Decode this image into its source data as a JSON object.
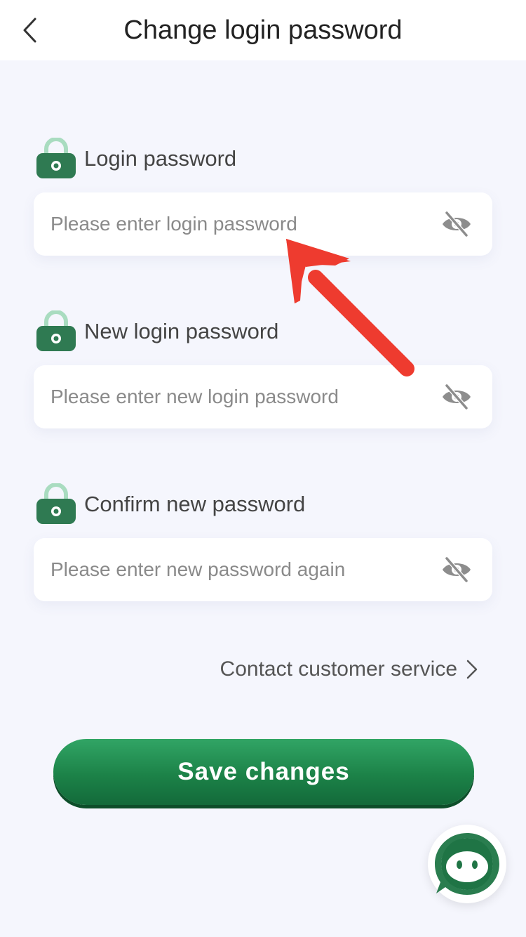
{
  "header": {
    "title": "Change login password",
    "back_icon": "chevron-left-icon"
  },
  "fields": [
    {
      "label": "Login password",
      "placeholder": "Please enter login password",
      "value": "",
      "icon": "lock-icon",
      "toggle_icon": "eye-off-icon"
    },
    {
      "label": "New login password",
      "placeholder": "Please enter new login password",
      "value": "",
      "icon": "lock-icon",
      "toggle_icon": "eye-off-icon"
    },
    {
      "label": "Confirm new password",
      "placeholder": "Please enter new password again",
      "value": "",
      "icon": "lock-icon",
      "toggle_icon": "eye-off-icon"
    }
  ],
  "contact": {
    "label": "Contact customer service",
    "icon": "chevron-right-icon"
  },
  "save_button": {
    "label": "Save changes"
  },
  "chat_widget": {
    "icon": "chat-bubble-icon"
  },
  "annotation": {
    "icon": "red-arrow-annotation"
  },
  "colors": {
    "background": "#f5f6fd",
    "brand_green": "#1c8248",
    "lock_green": "#2f7a52",
    "arrow_red": "#ee3b2f"
  }
}
